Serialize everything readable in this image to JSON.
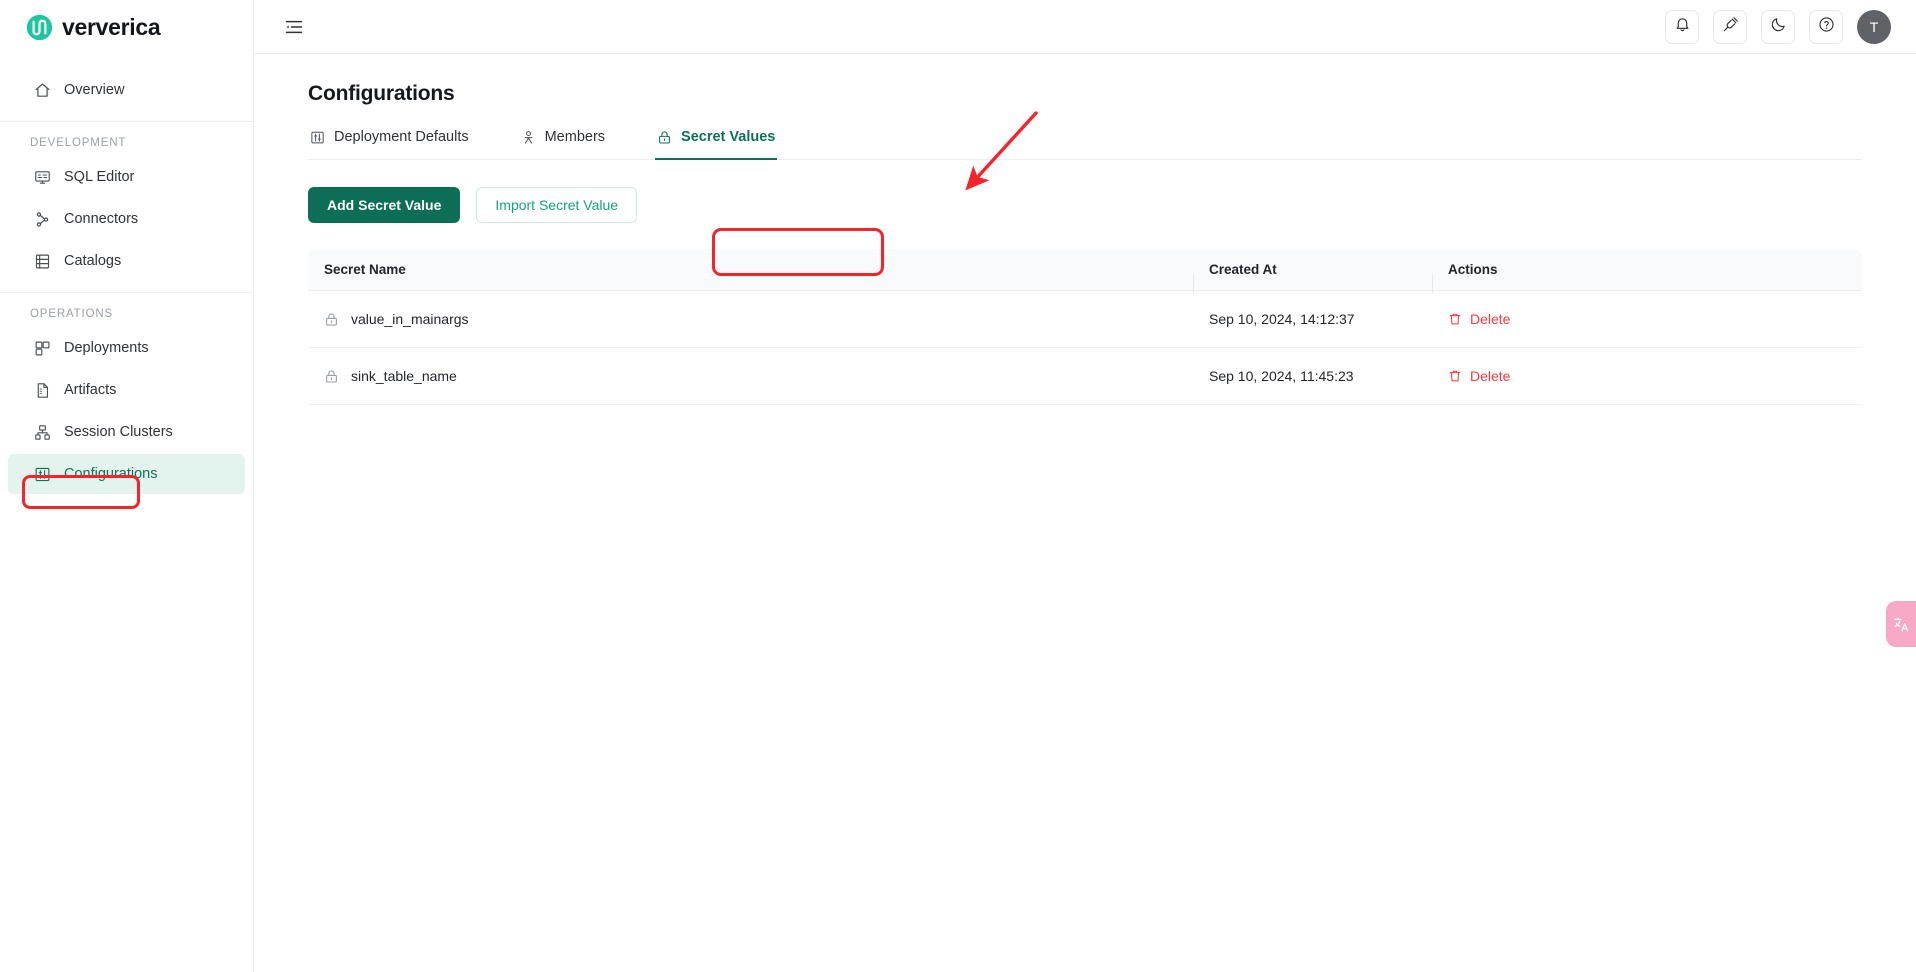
{
  "brand": {
    "name": "ververica",
    "logo_icon": "ververica-logo-icon"
  },
  "sidebar": {
    "items": [
      {
        "label": "Overview",
        "icon": "home-icon",
        "active": false
      },
      {
        "label": "SQL Editor",
        "icon": "sql-monitor-icon",
        "active": false
      },
      {
        "label": "Connectors",
        "icon": "connectors-icon",
        "active": false
      },
      {
        "label": "Catalogs",
        "icon": "catalog-icon",
        "active": false
      },
      {
        "label": "Deployments",
        "icon": "deployments-icon",
        "active": false
      },
      {
        "label": "Artifacts",
        "icon": "artifacts-file-icon",
        "active": false
      },
      {
        "label": "Session Clusters",
        "icon": "session-clusters-icon",
        "active": false
      },
      {
        "label": "Configurations",
        "icon": "configurations-sliders-icon",
        "active": true
      }
    ],
    "sections": {
      "development": "DEVELOPMENT",
      "operations": "OPERATIONS"
    }
  },
  "topbar": {
    "collapse_icon": "sidebar-collapse-icon",
    "actions": [
      {
        "icon": "bell-icon",
        "name": "notifications-button"
      },
      {
        "icon": "plug-icon",
        "name": "connection-button"
      },
      {
        "icon": "moon-icon",
        "name": "dark-mode-toggle"
      },
      {
        "icon": "help-circle-icon",
        "name": "help-button"
      }
    ],
    "avatar_initial": "T"
  },
  "page": {
    "title": "Configurations",
    "tabs": [
      {
        "label": "Deployment Defaults",
        "icon": "sliders-icon",
        "active": false
      },
      {
        "label": "Members",
        "icon": "members-icon",
        "active": false
      },
      {
        "label": "Secret Values",
        "icon": "lock-icon",
        "active": true
      }
    ],
    "buttons": {
      "add": "Add Secret Value",
      "import": "Import Secret Value"
    }
  },
  "table": {
    "columns": [
      "Secret Name",
      "Created At",
      "Actions"
    ],
    "rows": [
      {
        "name": "value_in_mainargs",
        "created_at": "Sep 10, 2024, 14:12:37",
        "action": "Delete",
        "icon": "lock-icon"
      },
      {
        "name": "sink_table_name",
        "created_at": "Sep 10, 2024, 11:45:23",
        "action": "Delete",
        "icon": "lock-icon"
      }
    ]
  },
  "widgets": {
    "translate": {
      "icon": "translate-icon",
      "label": ""
    }
  },
  "colors": {
    "brand_green": "#0d6e56",
    "accent_teal": "#13a37d",
    "active_bg": "#e3f4ee",
    "danger_red": "#f5393f",
    "annotation_red": "#f5242a",
    "translate_pink": "#f7a8c4"
  }
}
